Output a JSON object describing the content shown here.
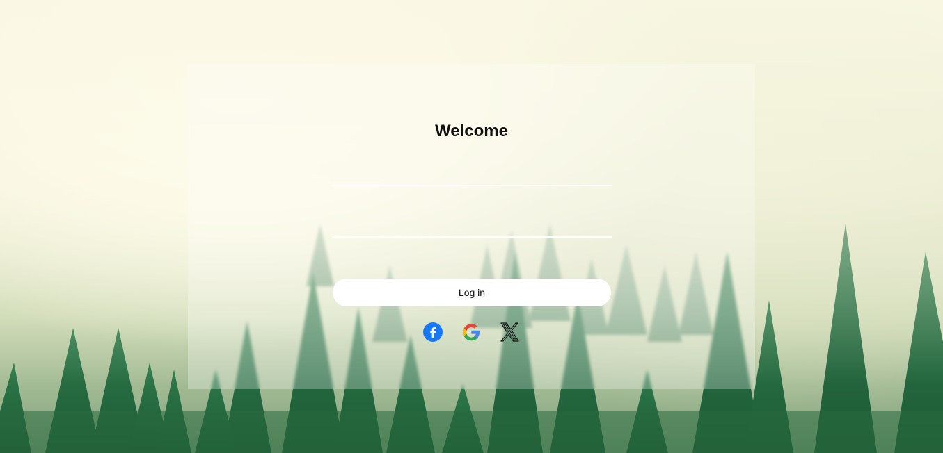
{
  "page": {
    "title": "Welcome"
  },
  "form": {
    "username_value": "",
    "username_placeholder": "",
    "password_value": "",
    "password_placeholder": "",
    "login_label": "Log in"
  },
  "social": [
    {
      "icon": "facebook-icon",
      "color": "#1877f2"
    },
    {
      "icon": "google-icon",
      "color": "#4285f4"
    },
    {
      "icon": "x-icon",
      "color": "#111111"
    }
  ],
  "colors": {
    "card_overlay": "#ffffff",
    "input_underline": "#ffffff",
    "button_bg": "#ffffff"
  }
}
